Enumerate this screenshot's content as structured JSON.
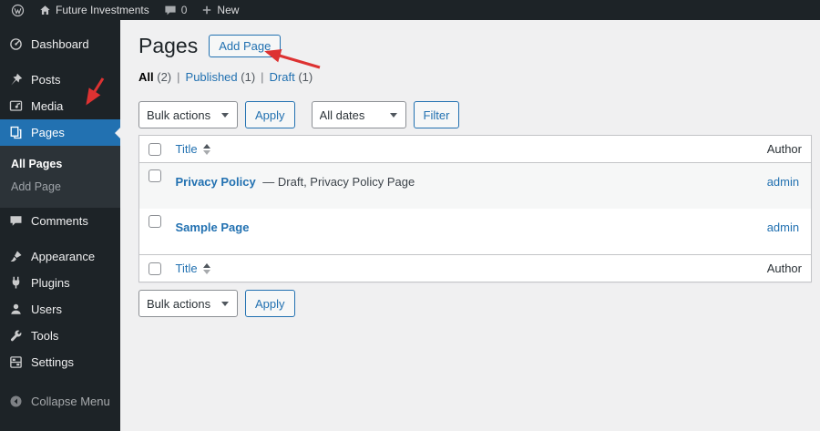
{
  "admin_bar": {
    "site_name": "Future Investments",
    "comments_count": "0",
    "new_label": "New"
  },
  "sidebar": {
    "items": [
      {
        "label": "Dashboard",
        "icon": "dashboard-icon"
      },
      {
        "label": "Posts",
        "icon": "pin-icon"
      },
      {
        "label": "Media",
        "icon": "media-icon"
      },
      {
        "label": "Pages",
        "icon": "pages-icon",
        "active": true
      },
      {
        "label": "Comments",
        "icon": "comments-icon"
      },
      {
        "label": "Appearance",
        "icon": "appearance-icon"
      },
      {
        "label": "Plugins",
        "icon": "plugin-icon"
      },
      {
        "label": "Users",
        "icon": "users-icon"
      },
      {
        "label": "Tools",
        "icon": "tools-icon"
      },
      {
        "label": "Settings",
        "icon": "settings-icon"
      }
    ],
    "submenu": [
      {
        "label": "All Pages",
        "current": true
      },
      {
        "label": "Add Page"
      }
    ],
    "collapse_label": "Collapse Menu"
  },
  "header": {
    "title": "Pages",
    "add_button": "Add Page"
  },
  "filters": {
    "all_label": "All",
    "all_count": "(2)",
    "published_label": "Published",
    "published_count": "(1)",
    "draft_label": "Draft",
    "draft_count": "(1)",
    "separator": "|"
  },
  "toolbar": {
    "bulk_actions": "Bulk actions",
    "apply": "Apply",
    "all_dates": "All dates",
    "filter": "Filter"
  },
  "table": {
    "columns": {
      "title": "Title",
      "author": "Author"
    },
    "rows": [
      {
        "title": "Privacy Policy",
        "state": "— Draft, Privacy Policy Page",
        "author": "admin"
      },
      {
        "title": "Sample Page",
        "state": "",
        "author": "admin"
      }
    ]
  },
  "colors": {
    "accent": "#2271b1",
    "annotation": "#dd3232",
    "admin_bar_bg": "#1d2327",
    "content_bg": "#f0f0f1"
  }
}
